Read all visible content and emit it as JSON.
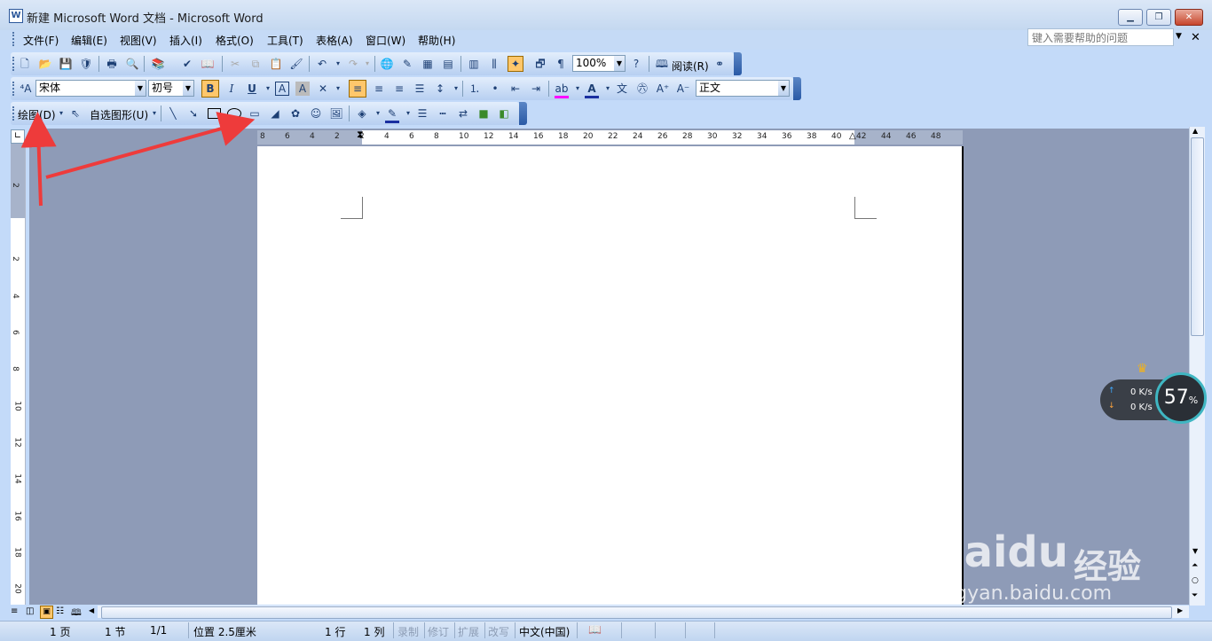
{
  "window": {
    "title": "新建 Microsoft Word 文档 - Microsoft Word",
    "app_icon": "word-doc-icon",
    "buttons": [
      "minimize",
      "restore",
      "close"
    ]
  },
  "menubar": {
    "items": [
      "文件(F)",
      "编辑(E)",
      "视图(V)",
      "插入(I)",
      "格式(O)",
      "工具(T)",
      "表格(A)",
      "窗口(W)",
      "帮助(H)"
    ],
    "help_placeholder": "键入需要帮助的问题"
  },
  "standard_toolbar": {
    "zoom": "100%",
    "read_label": "阅读(R)"
  },
  "formatting_toolbar": {
    "font": "宋体",
    "size": "初号",
    "style": "正文"
  },
  "drawing_toolbar": {
    "draw_label": "绘图(D)",
    "autoshapes_label": "自选图形(U)"
  },
  "ruler": {
    "h_numbers": [
      "8",
      "6",
      "4",
      "2",
      "2",
      "4",
      "6",
      "8",
      "10",
      "12",
      "14",
      "16",
      "18",
      "20",
      "22",
      "24",
      "26",
      "28",
      "30",
      "32",
      "34",
      "36",
      "38",
      "40",
      "42",
      "44",
      "46",
      "48"
    ],
    "v_numbers": [
      "2",
      "2",
      "4",
      "6",
      "8",
      "10",
      "12",
      "14",
      "16",
      "18",
      "20"
    ]
  },
  "statusbar": {
    "page": "1 页",
    "section": "1 节",
    "pages": "1/1",
    "position": "位置 2.5厘米",
    "line": "1 行",
    "column": "1 列",
    "rec": "录制",
    "trk": "修订",
    "ext": "扩展",
    "ovr": "改写",
    "language": "中文(中国)"
  },
  "net_widget": {
    "up": "0 K/s",
    "down": "0 K/s",
    "percent": "57",
    "percent_unit": "%"
  },
  "watermark": {
    "logo": "Baidu",
    "cn": "经验",
    "url": "jingyan.baidu.com"
  },
  "colors": {
    "toolbar_bg": "#c3daf9",
    "canvas": "#8e9bb7",
    "annotation_arrow": "#ee3b3b"
  }
}
